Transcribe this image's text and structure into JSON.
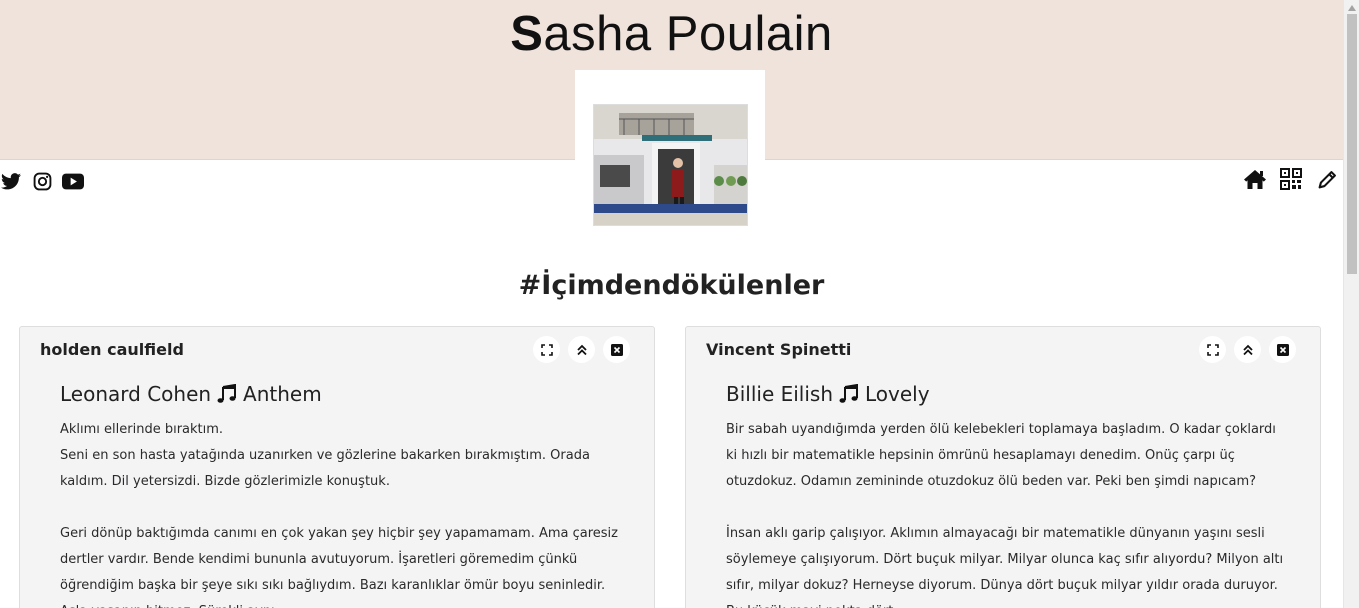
{
  "header": {
    "title_first": "S",
    "title_rest": "asha Poulain",
    "colors": {
      "band": "#efe3dc"
    }
  },
  "social_icons": [
    "twitter-icon",
    "instagram-icon",
    "youtube-icon"
  ],
  "nav_icons": [
    "home-icon",
    "qr-code-icon",
    "edit-icon"
  ],
  "section": {
    "hashtag": "#İçimdendökülenler"
  },
  "cards": [
    {
      "author": "holden caulfield",
      "song": "Leonard Cohen 🎵 Anthem",
      "song_artist": "Leonard Cohen",
      "song_name": "Anthem",
      "lines": [
        "Aklımı ellerinde bıraktım.",
        "Seni en son hasta yatağında uzanırken ve gözlerine bakarken bırakmıştım. Orada kaldım. Dil yetersizdi. Bizde gözlerimizle konuştuk.",
        "",
        "Geri dönüp baktığımda canımı en çok yakan şey hiçbir şey yapamamam. Ama çaresiz dertler vardır. Bende kendimi bununla avutuyorum. İşaretleri göremedim çünkü öğrendiğim başka bir şeye sıkı sıkı bağlıydım. Bazı karanlıklar ömür boyu seninledir. Asla yaşanıp bitmez. Sürekli aynı"
      ]
    },
    {
      "author": "Vincent Spinetti",
      "song": "Billie Eilish 🎵 Lovely",
      "song_artist": "Billie Eilish",
      "song_name": "Lovely",
      "lines": [
        "Bir sabah uyandığımda yerden ölü kelebekleri toplamaya başladım. O kadar çoklardı ki hızlı bir matematikle hepsinin ömrünü hesaplamayı denedim. Onüç çarpı üç otuzdokuz. Odamın zemininde otuzdokuz ölü beden var. Peki ben şimdi napıcam?",
        "",
        "İnsan aklı garip çalışıyor. Aklımın almayacağı bir matematikle dünyanın yaşını sesli söylemeye çalışıyorum. Dört buçuk milyar. Milyar olunca kaç sıfır alıyordu? Milyon altı sıfır, milyar dokuz? Herneyse diyorum. Dünya dört buçuk milyar yıldır orada duruyor. Bu küçük mavi nokta dört"
      ]
    }
  ],
  "card_tools": [
    "expand-icon",
    "collapse-icon",
    "close-icon"
  ]
}
